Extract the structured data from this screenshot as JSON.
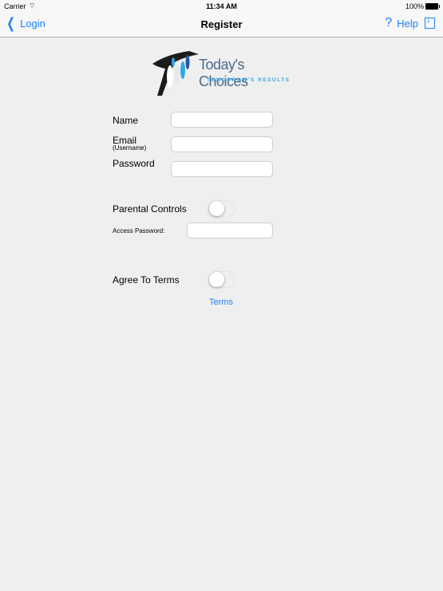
{
  "status_bar": {
    "carrier": "Carrier",
    "wifi_icon": "wifi-icon",
    "time": "11:34 AM",
    "battery_percent": "100%",
    "battery_icon": "battery-icon"
  },
  "nav_bar": {
    "back_label": "Login",
    "back_icon": "chevron-left-icon",
    "title": "Register",
    "help_icon": "question-mark-icon",
    "help_label": "Help",
    "share_icon": "download-icon"
  },
  "logo": {
    "title": "Today's Choices",
    "tagline": "TOMORROW'S RESULTS"
  },
  "form": {
    "name_label": "Name",
    "name_value": "",
    "email_label": "Email",
    "email_sublabel": "(Username)",
    "email_value": "",
    "password_label": "Password",
    "password_value": "",
    "parental_controls_label": "Parental Controls",
    "parental_controls_on": false,
    "access_password_label": "Access Password:",
    "access_password_value": "",
    "agree_terms_label": "Agree To Terms",
    "agree_terms_on": false,
    "terms_link": "Terms"
  }
}
